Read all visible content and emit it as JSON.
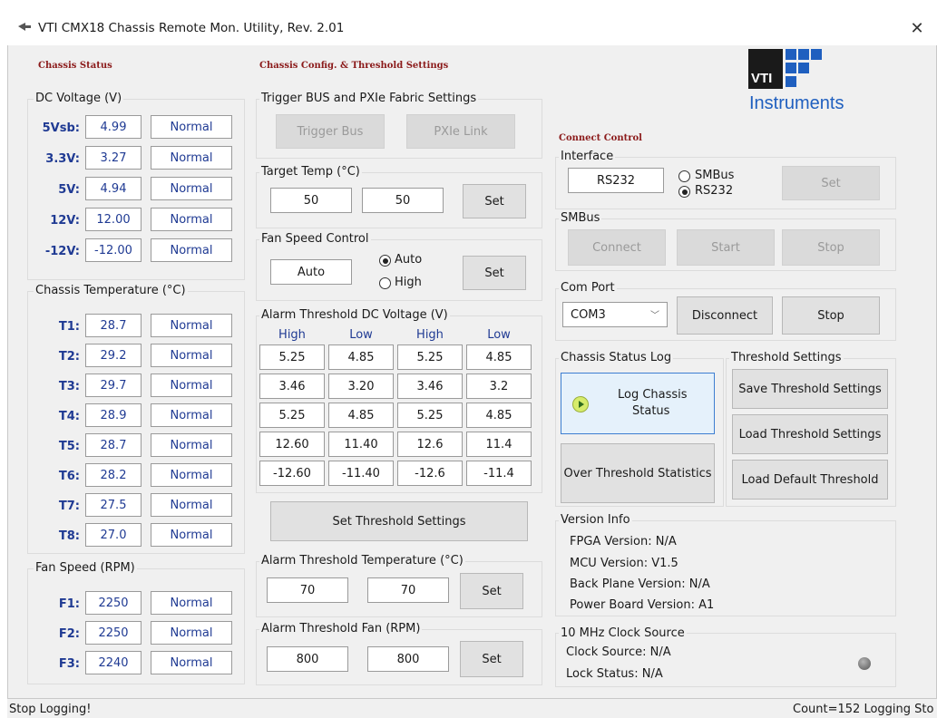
{
  "window": {
    "title": "VTI CMX18 Chassis Remote Mon. Utility, Rev. 2.01"
  },
  "logo": {
    "line1": "VTI",
    "line2": "Instruments"
  },
  "chassis_status": {
    "heading": "Chassis Status",
    "dc_voltage": {
      "label": "DC Voltage (V)",
      "rows": [
        {
          "name": "5Vsb:",
          "value": "4.99",
          "status": "Normal"
        },
        {
          "name": "3.3V:",
          "value": "3.27",
          "status": "Normal"
        },
        {
          "name": "5V:",
          "value": "4.94",
          "status": "Normal"
        },
        {
          "name": "12V:",
          "value": "12.00",
          "status": "Normal"
        },
        {
          "name": "-12V:",
          "value": "-12.00",
          "status": "Normal"
        }
      ]
    },
    "temperature": {
      "label": "Chassis Temperature (°C)",
      "rows": [
        {
          "name": "T1:",
          "value": "28.7",
          "status": "Normal"
        },
        {
          "name": "T2:",
          "value": "29.2",
          "status": "Normal"
        },
        {
          "name": "T3:",
          "value": "29.7",
          "status": "Normal"
        },
        {
          "name": "T4:",
          "value": "28.9",
          "status": "Normal"
        },
        {
          "name": "T5:",
          "value": "28.7",
          "status": "Normal"
        },
        {
          "name": "T6:",
          "value": "28.2",
          "status": "Normal"
        },
        {
          "name": "T7:",
          "value": "27.5",
          "status": "Normal"
        },
        {
          "name": "T8:",
          "value": "27.0",
          "status": "Normal"
        }
      ]
    },
    "fan_speed": {
      "label": "Fan Speed (RPM)",
      "rows": [
        {
          "name": "F1:",
          "value": "2250",
          "status": "Normal"
        },
        {
          "name": "F2:",
          "value": "2250",
          "status": "Normal"
        },
        {
          "name": "F3:",
          "value": "2240",
          "status": "Normal"
        }
      ]
    }
  },
  "config": {
    "heading": "Chassis Config. & Threshold Settings",
    "trigger": {
      "label": "Trigger BUS and PXIe Fabric Settings",
      "trigger_bus": "Trigger Bus",
      "pxie_link": "PXIe Link"
    },
    "target_temp": {
      "label": "Target Temp (°C)",
      "current": "50",
      "input": "50",
      "set": "Set"
    },
    "fan_control": {
      "label": "Fan Speed Control",
      "current": "Auto",
      "opt_auto": "Auto",
      "opt_high": "High",
      "set": "Set"
    },
    "alarm_dc": {
      "label": "Alarm Threshold DC Voltage (V)",
      "headers": [
        "High",
        "Low",
        "High",
        "Low"
      ],
      "rows": [
        [
          "5.25",
          "4.85",
          "5.25",
          "4.85"
        ],
        [
          "3.46",
          "3.20",
          "3.46",
          "3.2"
        ],
        [
          "5.25",
          "4.85",
          "5.25",
          "4.85"
        ],
        [
          "12.60",
          "11.40",
          "12.6",
          "11.4"
        ],
        [
          "-12.60",
          "-11.40",
          "-12.6",
          "-11.4"
        ]
      ],
      "set_button": "Set Threshold Settings"
    },
    "alarm_temp": {
      "label": "Alarm Threshold Temperature (°C)",
      "current": "70",
      "input": "70",
      "set": "Set"
    },
    "alarm_fan": {
      "label": "Alarm Threshold Fan (RPM)",
      "current": "800",
      "input": "800",
      "set": "Set"
    }
  },
  "connect": {
    "heading": "Connect Control",
    "interface": {
      "label": "Interface",
      "current": "RS232",
      "opt_smbus": "SMBus",
      "opt_rs232": "RS232",
      "set": "Set"
    },
    "smbus": {
      "label": "SMBus",
      "connect": "Connect",
      "start": "Start",
      "stop": "Stop"
    },
    "comport": {
      "label": "Com Port",
      "selected": "COM3",
      "disconnect": "Disconnect",
      "stop": "Stop"
    },
    "log": {
      "label": "Chassis Status Log",
      "log_button_line1": "Log Chassis",
      "log_button_line2": "Status",
      "over_threshold": "Over Threshold Statistics"
    },
    "threshold": {
      "label": "Threshold Settings",
      "save": "Save Threshold Settings",
      "load": "Load Threshold Settings",
      "load_default": "Load Default Threshold"
    },
    "version": {
      "label": "Version Info",
      "fpga": "FPGA Version: N/A",
      "mcu": "MCU Version: V1.5",
      "backplane": "Back Plane Version: N/A",
      "power": "Power Board Version: A1"
    },
    "clock": {
      "label": "10 MHz Clock Source",
      "source": "Clock Source: N/A",
      "lock": "Lock Status: N/A"
    }
  },
  "status_bar": {
    "left": "Stop Logging!",
    "right": "Count=152  Logging Sto"
  },
  "colors": {
    "value_text": "#1f3a93",
    "section_heading": "#8b1a1a",
    "logo_blue": "#1f5fbf"
  }
}
